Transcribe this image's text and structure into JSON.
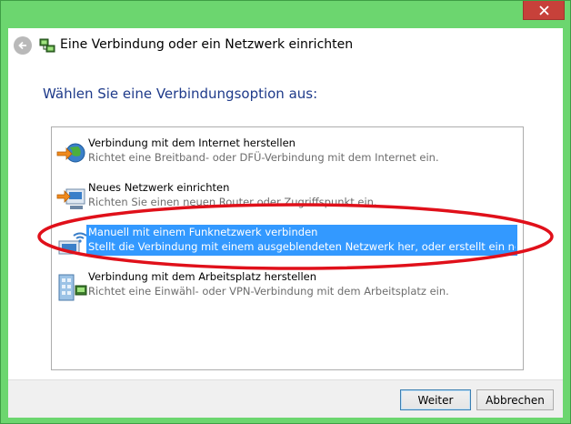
{
  "dialog": {
    "title": "Eine Verbindung oder ein Netzwerk einrichten",
    "heading": "Wählen Sie eine Verbindungsoption aus:"
  },
  "options": [
    {
      "title": "Verbindung mit dem Internet herstellen",
      "description": "Richtet eine Breitband- oder DFÜ-Verbindung mit dem Internet ein.",
      "icon": "globe-internet-icon"
    },
    {
      "title": "Neues Netzwerk einrichten",
      "description": "Richten Sie einen neuen Router oder Zugriffspunkt ein.",
      "icon": "router-icon"
    },
    {
      "title": "Manuell mit einem Funknetzwerk verbinden",
      "description": "Stellt die Verbindung mit einem ausgeblendeten Netzwerk her, oder erstellt ein neues F...",
      "icon": "wireless-network-icon",
      "selected": true
    },
    {
      "title": "Verbindung mit dem Arbeitsplatz herstellen",
      "description": "Richtet eine Einwähl- oder VPN-Verbindung mit dem Arbeitsplatz ein.",
      "icon": "workplace-building-icon"
    }
  ],
  "buttons": {
    "next": "Weiter",
    "cancel": "Abbrechen"
  },
  "colors": {
    "window_frame": "#6cd66f",
    "heading_text": "#1e3a8a",
    "selection": "#3399ff",
    "close_button": "#c7413a",
    "annotation_ring": "#e0101a"
  }
}
